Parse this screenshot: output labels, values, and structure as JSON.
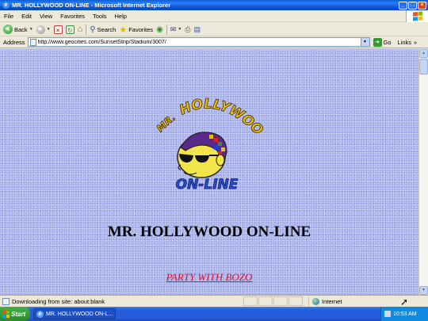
{
  "window": {
    "title": "MR. HOLLYWOOD ON-LINE - Microsoft Internet Explorer",
    "controls": [
      "_",
      "□",
      "×"
    ]
  },
  "menu": {
    "items": [
      "File",
      "Edit",
      "View",
      "Favorites",
      "Tools",
      "Help"
    ]
  },
  "toolbar": {
    "back_label": "Back",
    "search_label": "Search",
    "favorites_label": "Favorites"
  },
  "address": {
    "label": "Address",
    "url": "http://www.geocities.com/SunsetStrip/Stadium/3007/",
    "go_label": "Go",
    "links_label": "Links",
    "links_chevron": "»"
  },
  "page": {
    "logo": {
      "text_top": "MR.",
      "text_main": "HOLLYWOOD",
      "text_bottom": "ON-LINE"
    },
    "heading": "MR. HOLLYWOOD ON-LINE",
    "link_text": "PARTY WITH BOZO"
  },
  "status": {
    "text": "Downloading from site: about:blank",
    "zone": "Internet"
  },
  "taskbar": {
    "start_label": "Start",
    "task_label": "MR. HOLLYWOOD ON-L...",
    "clock": "10:53 AM"
  },
  "colors": {
    "titlebar": "#0a56d0",
    "link": "#e0102a",
    "background_texture": "#aab2ec",
    "logo_text": "#f0c000"
  },
  "icons": [
    "back-icon",
    "forward-icon",
    "stop-icon",
    "refresh-icon",
    "home-icon",
    "search-icon",
    "favorites-icon",
    "media-icon",
    "history-icon",
    "mail-icon",
    "print-icon",
    "edit-icon",
    "globe-icon",
    "windows-flag-icon"
  ]
}
